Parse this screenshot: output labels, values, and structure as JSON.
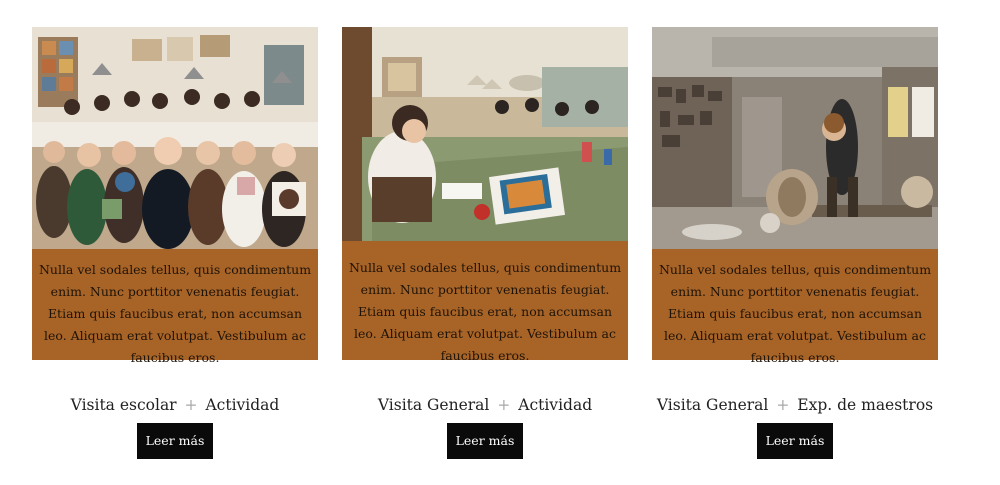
{
  "cards": [
    {
      "caption": "Nulla vel sodales tellus, quis condimentum enim. Nunc porttitor venenatis feugiat. Etiam quis faucibus erat, non accumsan leo. Aliquam erat volutpat. Vestibulum ac faucibus eros.",
      "title_a": "Visita escolar",
      "title_plus": "+",
      "title_b": "Actividad",
      "button": "Leer más"
    },
    {
      "caption": "Nulla vel sodales tellus, quis condimentum enim. Nunc porttitor venenatis feugiat. Etiam quis faucibus erat, non accumsan leo. Aliquam erat volutpat. Vestibulum ac faucibus eros.",
      "title_a": "Visita General",
      "title_plus": "+",
      "title_b": "Actividad",
      "button": "Leer más"
    },
    {
      "caption": "Nulla vel sodales tellus, quis condimentum enim. Nunc porttitor venenatis feugiat. Etiam quis faucibus erat, non accumsan leo. Aliquam erat volutpat. Vestibulum ac faucibus eros.",
      "title_a": "Visita General",
      "title_plus": "+",
      "title_b": "Exp. de maestros",
      "button": "Leer más"
    }
  ],
  "colors": {
    "caption_bg": "#a86427",
    "button_bg": "#0a0a0a",
    "plus": "#a8a8a8"
  }
}
